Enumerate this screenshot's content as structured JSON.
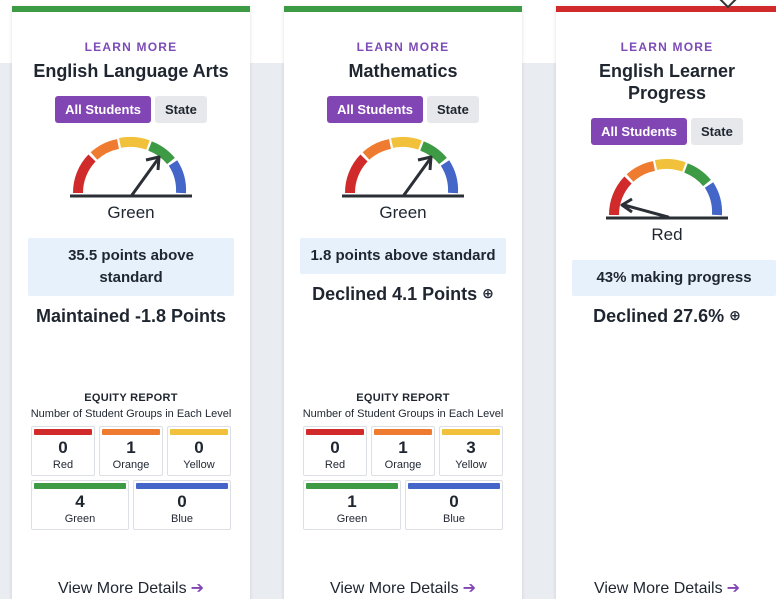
{
  "colors": {
    "red": "#d12a2a",
    "orange": "#ee7b30",
    "yellow": "#f2c13b",
    "green": "#3d9a45",
    "blue": "#4466c9",
    "purple": "#8146b4"
  },
  "cards": [
    {
      "learn_more": "LEARN MORE",
      "subject": "English Language Arts",
      "toggle_all": "All Students",
      "toggle_state": "State",
      "gauge_level": "green",
      "color_label": "Green",
      "status": "35.5 points above standard",
      "change": "Maintained -1.8 Points",
      "equity_title": "EQUITY REPORT",
      "equity_sub": "Number of Student Groups in Each Level",
      "counts": {
        "red": "0",
        "orange": "1",
        "yellow": "0",
        "green": "4",
        "blue": "0"
      },
      "levels": {
        "red": "Red",
        "orange": "Orange",
        "yellow": "Yellow",
        "green": "Green",
        "blue": "Blue"
      },
      "details": "View More Details",
      "arrow": "➔"
    },
    {
      "learn_more": "LEARN MORE",
      "subject": "Mathematics",
      "toggle_all": "All Students",
      "toggle_state": "State",
      "gauge_level": "green",
      "color_label": "Green",
      "status": "1.8 points above standard",
      "change": "Declined 4.1 Points",
      "change_icon": "⊕",
      "equity_title": "EQUITY REPORT",
      "equity_sub": "Number of Student Groups in Each Level",
      "counts": {
        "red": "0",
        "orange": "1",
        "yellow": "3",
        "green": "1",
        "blue": "0"
      },
      "levels": {
        "red": "Red",
        "orange": "Orange",
        "yellow": "Yellow",
        "green": "Green",
        "blue": "Blue"
      },
      "details": "View More Details",
      "arrow": "➔"
    },
    {
      "learn_more": "LEARN MORE",
      "subject": "English Learner Progress",
      "toggle_all": "All Students",
      "toggle_state": "State",
      "gauge_level": "red",
      "color_label": "Red",
      "status": "43% making progress",
      "change": "Declined 27.6%",
      "change_icon": "⊕",
      "details": "View More Details",
      "arrow": "➔"
    }
  ]
}
